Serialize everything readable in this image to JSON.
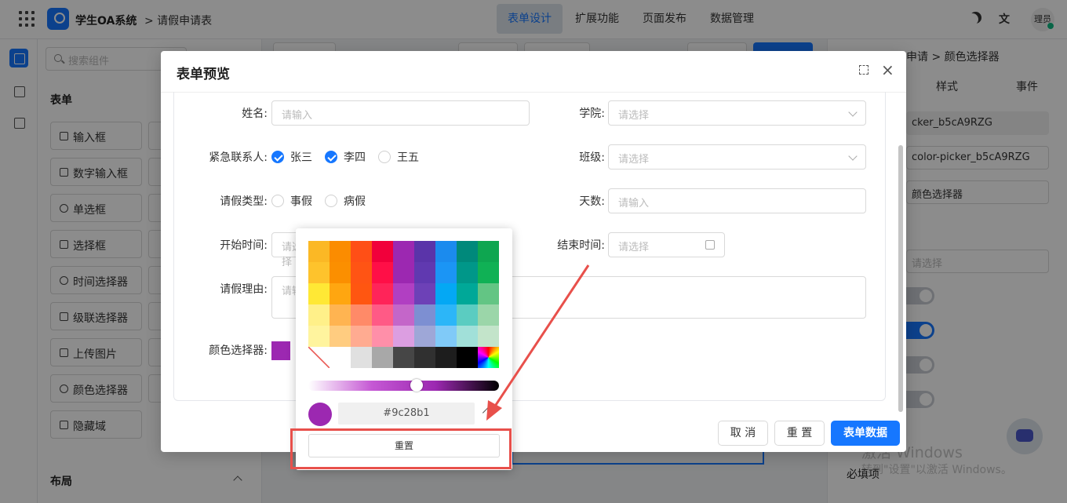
{
  "app": {
    "title": "学生OA系统",
    "breadcrumb": "> 请假申请表"
  },
  "topnav": [
    "表单设计",
    "扩展功能",
    "页面发布",
    "数据管理"
  ],
  "user": {
    "avatar_text": "理员"
  },
  "left_panel": {
    "search_placeholder": "搜索组件",
    "form_section": "表单",
    "components": [
      "输入框",
      "数字输入框",
      "单选框",
      "选择框",
      "时间选择器",
      "级联选择器",
      "上传图片",
      "颜色选择器",
      "隐藏域"
    ],
    "layout_section": "布局"
  },
  "right_panel": {
    "breadcrumb": "申请 > 颜色选择器",
    "tabs": [
      "样式",
      "事件"
    ],
    "field_id_short": "cker_b5cA9RZG",
    "field_id": "color-picker_b5cA9RZG",
    "field_label": "颜色选择器",
    "select_placeholder": "请选择",
    "required_label": "必填项",
    "watermark_line1": "激活 Windows",
    "watermark_line2": "转到\"设置\"以激活 Windows。"
  },
  "modal": {
    "title": "表单预览",
    "fields": {
      "name_label": "姓名:",
      "name_placeholder": "请输入",
      "college_label": "学院:",
      "college_placeholder": "请选择",
      "contact_label": "紧急联系人:",
      "contact_options": [
        "张三",
        "李四",
        "王五"
      ],
      "class_label": "班级:",
      "class_placeholder": "请选择",
      "leave_type_label": "请假类型:",
      "leave_type_options": [
        "事假",
        "病假"
      ],
      "days_label": "天数:",
      "days_placeholder": "请输入",
      "start_label": "开始时间:",
      "start_placeholder": "请选择",
      "end_label": "结束时间:",
      "end_placeholder": "请选择",
      "reason_label": "请假理由:",
      "reason_placeholder": "请输入",
      "color_label": "颜色选择器:"
    },
    "buttons": {
      "cancel": "取 消",
      "reset": "重 置",
      "submit": "表单数据"
    }
  },
  "color_picker": {
    "value": "#9c28b1",
    "reset_label": "重置",
    "palette": [
      [
        "#fbb825",
        "#fb8c00",
        "#ff4f16",
        "#f1003b",
        "#9c28b1",
        "#5a34a9",
        "#1b8bee",
        "#00897b",
        "#0ea650"
      ],
      [
        "#fec32c",
        "#fb8f00",
        "#ff5414",
        "#ff0f47",
        "#9c28b1",
        "#6039b0",
        "#1b95f5",
        "#009789",
        "#10b155"
      ],
      [
        "#ffe835",
        "#ffa610",
        "#ff5611",
        "#ff2459",
        "#b13fc2",
        "#6d41b7",
        "#04a8f4",
        "#00a898",
        "#63c584"
      ],
      [
        "#fff089",
        "#ffb451",
        "#ff8a68",
        "#ff5a86",
        "#c466c9",
        "#7d8fd2",
        "#2cb6f8",
        "#5bccc1",
        "#9bd6a9"
      ],
      [
        "#fff49e",
        "#ffcc80",
        "#ffab91",
        "#ff8fa9",
        "#dc9ee1",
        "#9ea7d7",
        "#80caf8",
        "#a1e0d9",
        "#c3e4ca"
      ],
      [
        "#ffffff",
        "#ffffff",
        "#e0e0e0",
        "#a8a8a8",
        "#464646",
        "#303030",
        "#1d1d1d",
        "#000000",
        "#rainbow"
      ]
    ],
    "accent": "#e8504b"
  }
}
